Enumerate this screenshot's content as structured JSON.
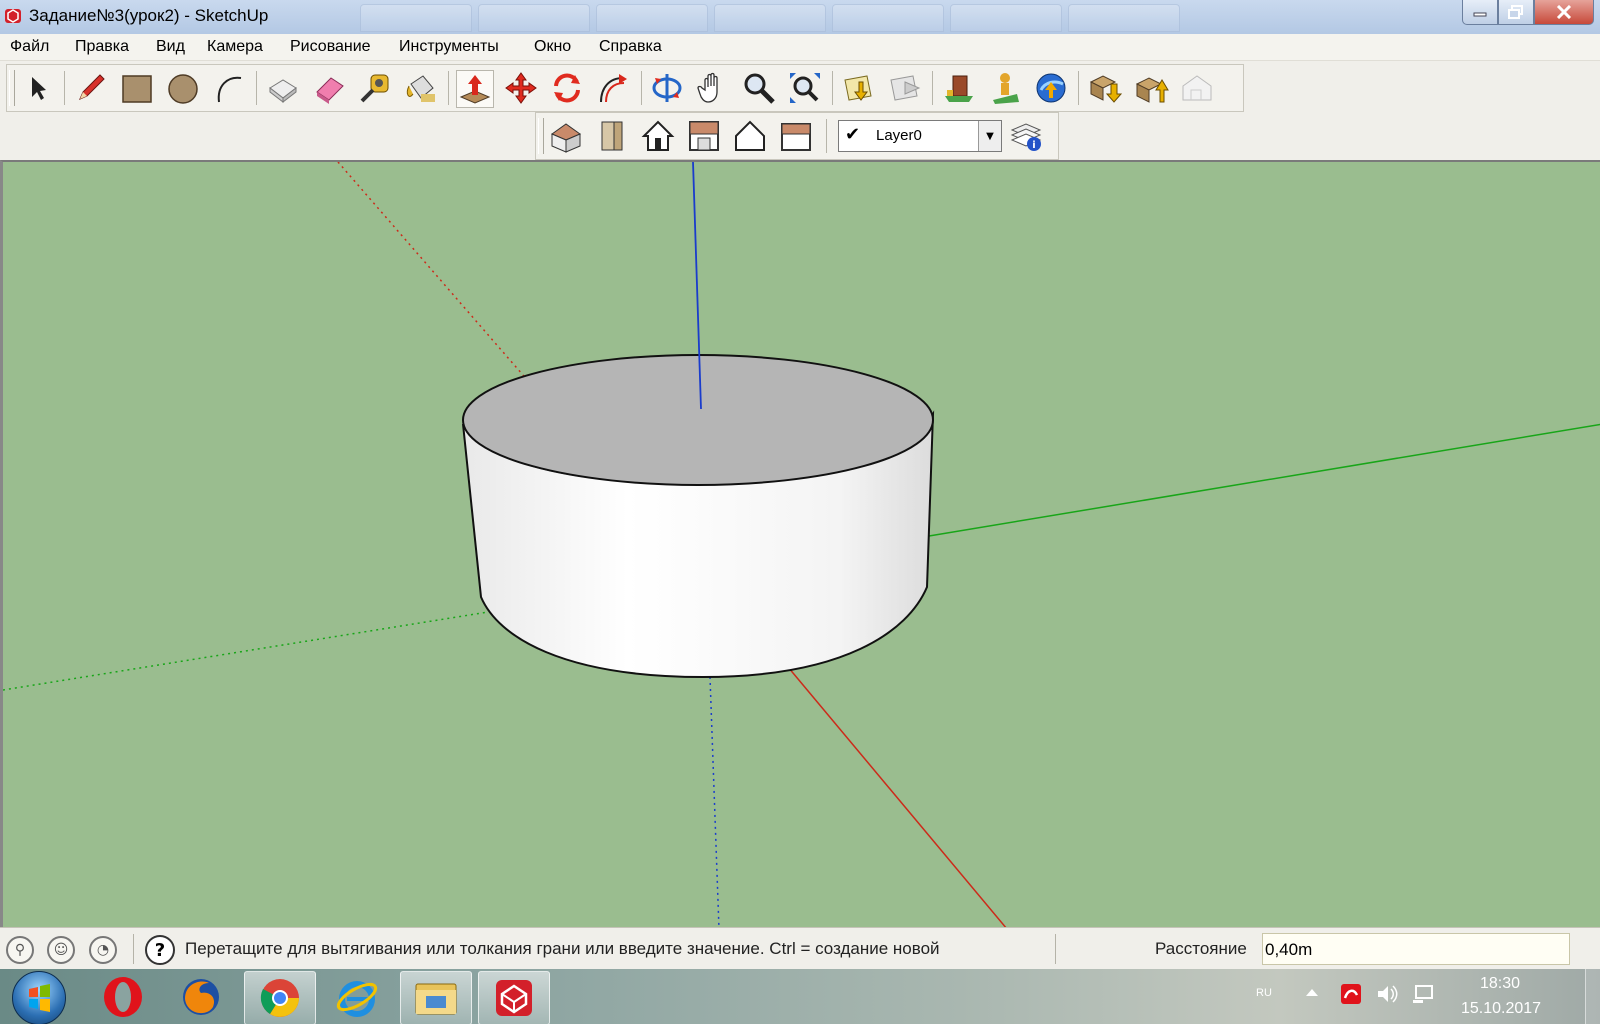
{
  "window": {
    "title": "Задание№3(урок2) - SketchUp"
  },
  "menu": [
    "Файл",
    "Правка",
    "Вид",
    "Камера",
    "Рисование",
    "Инструменты",
    "Окно",
    "Справка"
  ],
  "toolbar": {
    "main_tools": [
      "select-icon",
      "pencil-icon",
      "rectangle-icon",
      "circle-icon",
      "arc-icon",
      "make-component-icon",
      "eraser-icon",
      "tape-measure-icon",
      "paint-bucket-icon",
      "push-pull-icon",
      "move-icon",
      "rotate-icon",
      "offset-icon",
      "orbit-icon",
      "pan-icon",
      "zoom-icon",
      "zoom-extents-icon",
      "get-models-icon",
      "share-model-icon",
      "warehouse-icon",
      "add-location-icon",
      "google-earth-icon",
      "get-components-icon",
      "share-component-icon",
      "preview-icon"
    ],
    "view_tools": [
      "iso-view-icon",
      "front-view-icon",
      "home-view-icon",
      "top-view-icon",
      "back-view-icon",
      "side-view-icon"
    ],
    "layer": {
      "selected": "Layer0"
    }
  },
  "status": {
    "hint": "Перетащите для вытягивания или толкания грани или введите значение.  Ctrl = создание новой",
    "measure_label": "Расстояние",
    "measure_value": "0,40m"
  },
  "taskbar": {
    "apps": [
      "opera-icon",
      "firefox-icon",
      "chrome-icon",
      "ie-icon",
      "explorer-icon",
      "sketchup-icon"
    ],
    "lang": "RU",
    "time": "18:30",
    "date": "15.10.2017"
  },
  "colors": {
    "viewport_bg": "#9abd8f",
    "axis_red": "#cc2a1a",
    "axis_green": "#18a518",
    "axis_blue": "#1a3ccc"
  }
}
